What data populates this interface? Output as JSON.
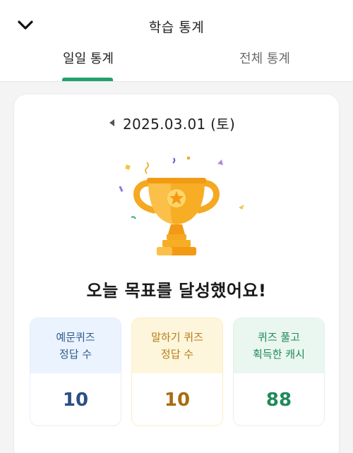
{
  "header": {
    "title": "학습 통계",
    "back_icon": "chevron-down-icon"
  },
  "tabs": [
    {
      "label": "일일 통계",
      "active": true
    },
    {
      "label": "전체 통계",
      "active": false
    }
  ],
  "accent_color": "#22a06b",
  "date": {
    "label": "2025.03.01 (토)",
    "prev_icon": "triangle-left-icon"
  },
  "achievement": {
    "icon": "trophy-icon",
    "message": "오늘 목표를 달성했어요!"
  },
  "stats": [
    {
      "title_line1": "예문퀴즈",
      "title_line2": "정답 수",
      "value": "10",
      "color": "#2b4f85"
    },
    {
      "title_line1": "말하기 퀴즈",
      "title_line2": "정답 수",
      "value": "10",
      "color": "#a86d0f"
    },
    {
      "title_line1": "퀴즈 풀고",
      "title_line2": "획득한 캐시",
      "value": "88",
      "color": "#1f8a59"
    }
  ]
}
